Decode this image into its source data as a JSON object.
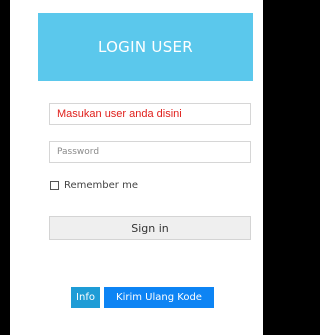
{
  "header": {
    "title": "LOGIN USER"
  },
  "form": {
    "username_value": "Masukan user anda disini",
    "password_placeholder": "Password",
    "remember_label": "Remember me",
    "remember_checked": false,
    "signin_label": "Sign in"
  },
  "footer": {
    "info_label": "Info",
    "resend_label": "Kirim Ulang Kode"
  },
  "colors": {
    "header_bg": "#5bc8ec",
    "username_text": "#e0201c",
    "primary_button": "#0d84f4",
    "info_button": "#1e9cd6"
  }
}
